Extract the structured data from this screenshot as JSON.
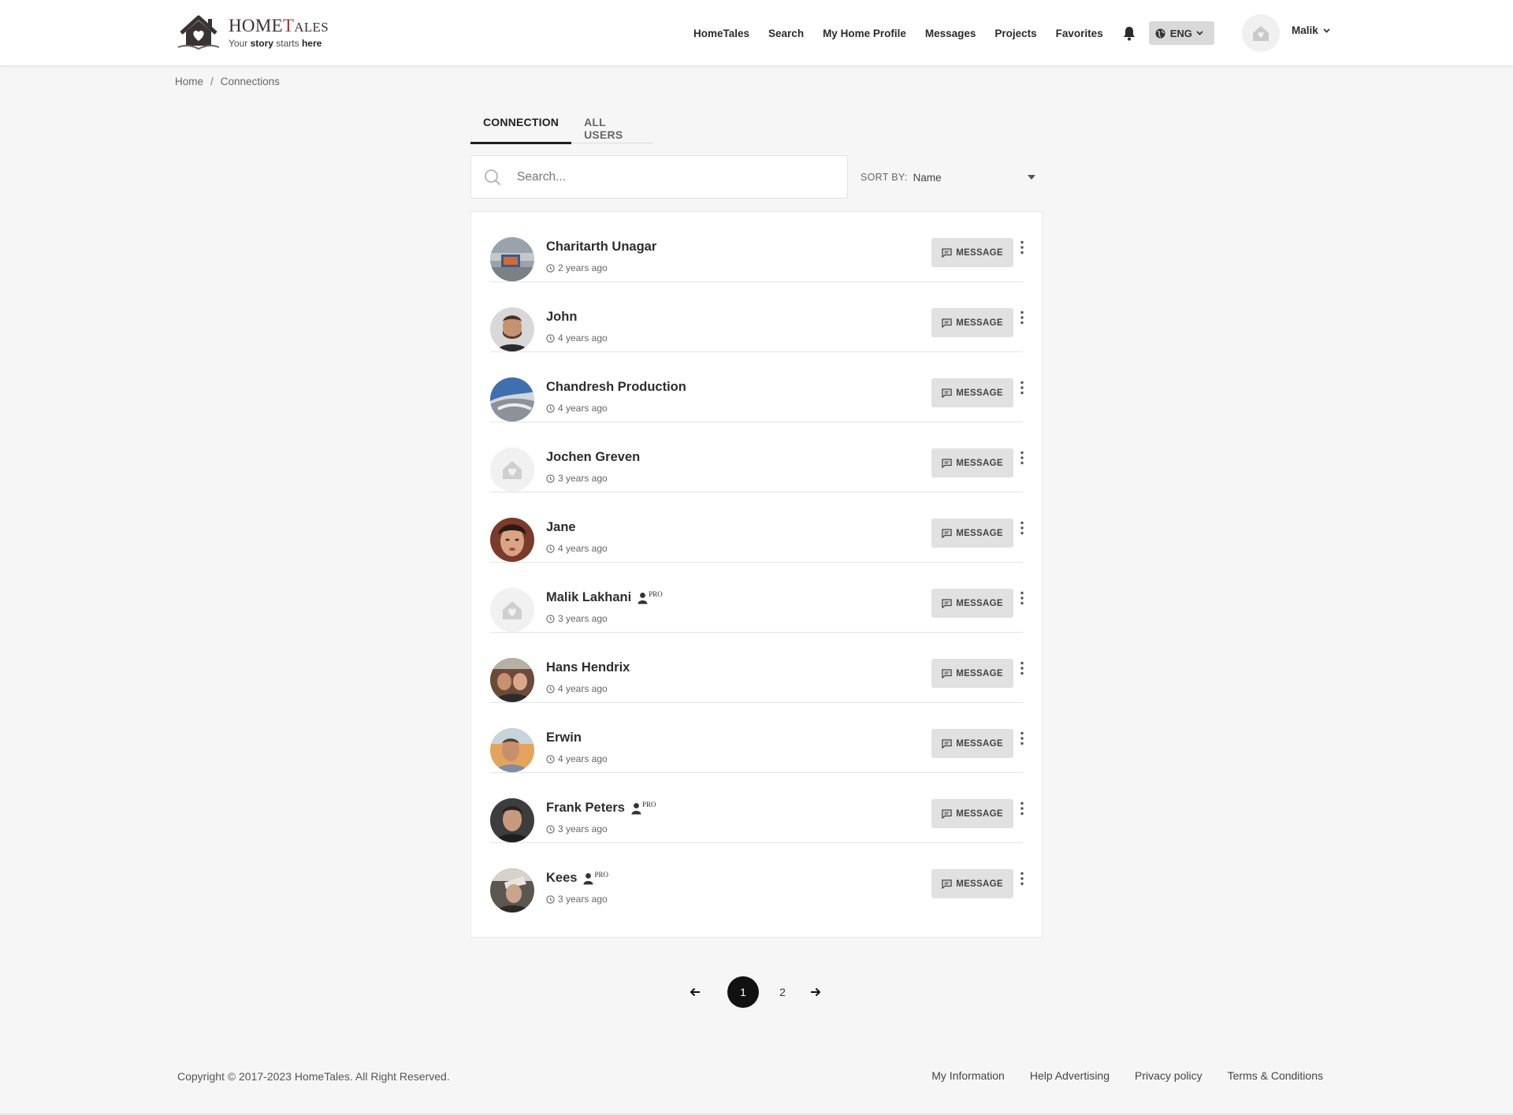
{
  "header": {
    "logo": {
      "title_main": "HOME",
      "title_accent": "T",
      "title_rest": "ALES",
      "tagline_pre": "Your ",
      "tagline_b1": "story",
      "tagline_mid": " starts ",
      "tagline_b2": "here"
    },
    "nav": [
      "HomeTales",
      "Search",
      "My Home Profile",
      "Messages",
      "Projects",
      "Favorites"
    ],
    "bell_icon": "bell-icon",
    "language": "ENG",
    "user_name": "Malik"
  },
  "breadcrumb": {
    "home": "Home",
    "separator": "/",
    "current": "Connections"
  },
  "tabs": {
    "connection": "CONNECTION",
    "all_users": "ALL USERS",
    "active": "connection"
  },
  "search": {
    "placeholder": "Search...",
    "value": ""
  },
  "sort": {
    "label": "SORT BY:",
    "value": "Name"
  },
  "connections": [
    {
      "name": "Charitarth Unagar",
      "time": "2 years ago",
      "pro": false,
      "message_label": "MESSAGE"
    },
    {
      "name": "John",
      "time": "4 years ago",
      "pro": false,
      "message_label": "MESSAGE"
    },
    {
      "name": "Chandresh Production",
      "time": "4 years ago",
      "pro": false,
      "message_label": "MESSAGE"
    },
    {
      "name": "Jochen Greven",
      "time": "3 years ago",
      "pro": false,
      "message_label": "MESSAGE"
    },
    {
      "name": "Jane",
      "time": "4 years ago",
      "pro": false,
      "message_label": "MESSAGE"
    },
    {
      "name": "Malik Lakhani",
      "time": "3 years ago",
      "pro": true,
      "pro_label": "PRO",
      "message_label": "MESSAGE"
    },
    {
      "name": "Hans Hendrix",
      "time": "4 years ago",
      "pro": false,
      "message_label": "MESSAGE"
    },
    {
      "name": "Erwin",
      "time": "4 years ago",
      "pro": false,
      "message_label": "MESSAGE"
    },
    {
      "name": "Frank Peters",
      "time": "3 years ago",
      "pro": true,
      "pro_label": "PRO",
      "message_label": "MESSAGE"
    },
    {
      "name": "Kees",
      "time": "3 years ago",
      "pro": true,
      "pro_label": "PRO",
      "message_label": "MESSAGE"
    }
  ],
  "pagination": {
    "pages": [
      "1",
      "2"
    ],
    "current": "1"
  },
  "footer": {
    "copyright": "Copyright © 2017-2023 HomeTales. All Right Reserved.",
    "links": [
      "My Information",
      "Help Advertising",
      "Privacy policy",
      "Terms & Conditions"
    ]
  },
  "colors": {
    "brand_accent": "#9a3a3d",
    "active_tab": "#1f1f1f",
    "message_button": "#e1e1e1",
    "page_background": "#f6f6f6"
  }
}
